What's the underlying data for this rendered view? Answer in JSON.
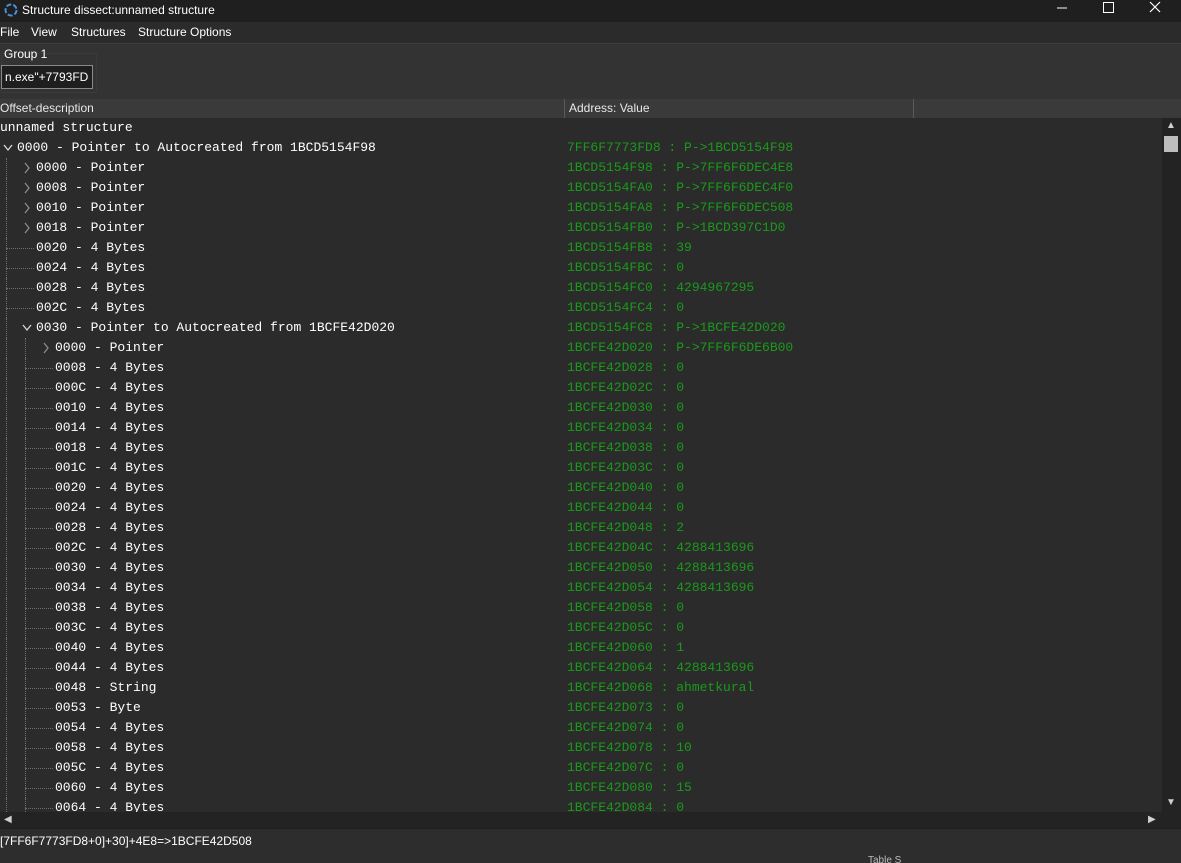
{
  "window": {
    "title": "Structure dissect:unnamed structure",
    "buttons": [
      "minimize",
      "maximize",
      "close"
    ]
  },
  "menu": [
    "File",
    "View",
    "Structures",
    "Structure Options"
  ],
  "group": {
    "label": "Group 1",
    "address_value": "n.exe\"+7793FD8"
  },
  "columns": [
    "Offset-description",
    "Address: Value"
  ],
  "tree": {
    "root_label": "unnamed structure",
    "rows": [
      {
        "indent": 0,
        "expander": "open",
        "desc": "0000 - Pointer to Autocreated from 1BCD5154F98",
        "value": "7FF6F7773FD8 : P->1BCD5154F98"
      },
      {
        "indent": 1,
        "expander": "closed",
        "desc": "0000 - Pointer",
        "value": "1BCD5154F98 : P->7FF6F6DEC4E8"
      },
      {
        "indent": 1,
        "expander": "closed",
        "desc": "0008 - Pointer",
        "value": "1BCD5154FA0 : P->7FF6F6DEC4F0"
      },
      {
        "indent": 1,
        "expander": "closed",
        "desc": "0010 - Pointer",
        "value": "1BCD5154FA8 : P->7FF6F6DEC508"
      },
      {
        "indent": 1,
        "expander": "closed",
        "desc": "0018 - Pointer",
        "value": "1BCD5154FB0 : P->1BCD397C1D0"
      },
      {
        "indent": 1,
        "expander": "none",
        "desc": "0020 - 4 Bytes",
        "value": "1BCD5154FB8 : 39"
      },
      {
        "indent": 1,
        "expander": "none",
        "desc": "0024 - 4 Bytes",
        "value": "1BCD5154FBC : 0"
      },
      {
        "indent": 1,
        "expander": "none",
        "desc": "0028 - 4 Bytes",
        "value": "1BCD5154FC0 : 4294967295"
      },
      {
        "indent": 1,
        "expander": "none",
        "desc": "002C - 4 Bytes",
        "value": "1BCD5154FC4 : 0"
      },
      {
        "indent": 1,
        "expander": "open",
        "desc": "0030 - Pointer to Autocreated from 1BCFE42D020",
        "value": "1BCD5154FC8 : P->1BCFE42D020"
      },
      {
        "indent": 2,
        "expander": "closed",
        "desc": "0000 - Pointer",
        "value": "1BCFE42D020 : P->7FF6F6DE6B00"
      },
      {
        "indent": 2,
        "expander": "none",
        "desc": "0008 - 4 Bytes",
        "value": "1BCFE42D028 : 0"
      },
      {
        "indent": 2,
        "expander": "none",
        "desc": "000C - 4 Bytes",
        "value": "1BCFE42D02C : 0"
      },
      {
        "indent": 2,
        "expander": "none",
        "desc": "0010 - 4 Bytes",
        "value": "1BCFE42D030 : 0"
      },
      {
        "indent": 2,
        "expander": "none",
        "desc": "0014 - 4 Bytes",
        "value": "1BCFE42D034 : 0"
      },
      {
        "indent": 2,
        "expander": "none",
        "desc": "0018 - 4 Bytes",
        "value": "1BCFE42D038 : 0"
      },
      {
        "indent": 2,
        "expander": "none",
        "desc": "001C - 4 Bytes",
        "value": "1BCFE42D03C : 0"
      },
      {
        "indent": 2,
        "expander": "none",
        "desc": "0020 - 4 Bytes",
        "value": "1BCFE42D040 : 0"
      },
      {
        "indent": 2,
        "expander": "none",
        "desc": "0024 - 4 Bytes",
        "value": "1BCFE42D044 : 0"
      },
      {
        "indent": 2,
        "expander": "none",
        "desc": "0028 - 4 Bytes",
        "value": "1BCFE42D048 : 2"
      },
      {
        "indent": 2,
        "expander": "none",
        "desc": "002C - 4 Bytes",
        "value": "1BCFE42D04C : 4288413696"
      },
      {
        "indent": 2,
        "expander": "none",
        "desc": "0030 - 4 Bytes",
        "value": "1BCFE42D050 : 4288413696"
      },
      {
        "indent": 2,
        "expander": "none",
        "desc": "0034 - 4 Bytes",
        "value": "1BCFE42D054 : 4288413696"
      },
      {
        "indent": 2,
        "expander": "none",
        "desc": "0038 - 4 Bytes",
        "value": "1BCFE42D058 : 0"
      },
      {
        "indent": 2,
        "expander": "none",
        "desc": "003C - 4 Bytes",
        "value": "1BCFE42D05C : 0"
      },
      {
        "indent": 2,
        "expander": "none",
        "desc": "0040 - 4 Bytes",
        "value": "1BCFE42D060 : 1"
      },
      {
        "indent": 2,
        "expander": "none",
        "desc": "0044 - 4 Bytes",
        "value": "1BCFE42D064 : 4288413696"
      },
      {
        "indent": 2,
        "expander": "none",
        "desc": "0048 - String",
        "value": "1BCFE42D068 : ahmetkural"
      },
      {
        "indent": 2,
        "expander": "none",
        "desc": "0053 - Byte",
        "value": "1BCFE42D073 : 0"
      },
      {
        "indent": 2,
        "expander": "none",
        "desc": "0054 - 4 Bytes",
        "value": "1BCFE42D074 : 0"
      },
      {
        "indent": 2,
        "expander": "none",
        "desc": "0058 - 4 Bytes",
        "value": "1BCFE42D078 : 10"
      },
      {
        "indent": 2,
        "expander": "none",
        "desc": "005C - 4 Bytes",
        "value": "1BCFE42D07C : 0"
      },
      {
        "indent": 2,
        "expander": "none",
        "desc": "0060 - 4 Bytes",
        "value": "1BCFE42D080 : 15"
      },
      {
        "indent": 2,
        "expander": "none",
        "desc": "0064 - 4 Bytes",
        "value": "1BCFE42D084 : 0"
      }
    ]
  },
  "status": {
    "text": "[7FF6F7773FD8+0]+30]+4E8=>1BCFE42D508",
    "partial": "Table S"
  },
  "colors": {
    "value_text": "#1a9a1a",
    "background": "#2b2b2b"
  }
}
